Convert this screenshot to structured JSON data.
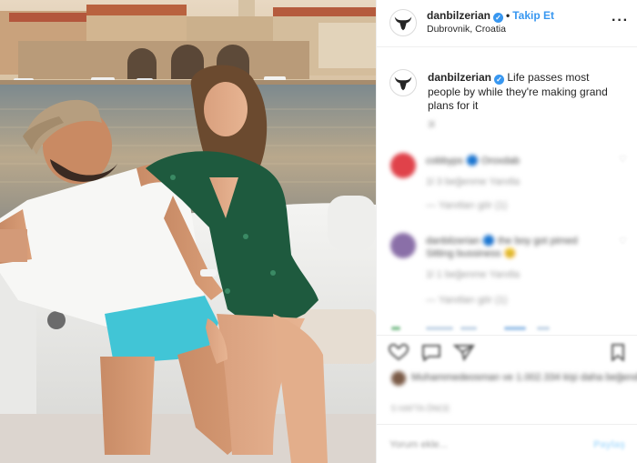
{
  "post": {
    "username": "danbilzerian",
    "separator": "•",
    "follow_label": "Takip Et",
    "location": "Dubrovnik, Croatia",
    "more_icon": "more-options-icon",
    "verified_icon": "verified-badge-icon"
  },
  "caption": {
    "username": "danbilzerian",
    "text": "Life passes most people by while they're making grand plans for it",
    "time": "3l"
  },
  "comments": [
    {
      "line1": "cobbyps 🔵 Oroxdab",
      "line2": "1l  3 beğenme  Yanıtla",
      "line3": "— Yanıtları gör (1)",
      "avatar_color": "#e0424a"
    },
    {
      "line1": "danbilzerian 🔵 the boy got pimed",
      "line2": "Sitting bussiness 😊",
      "line3": "1l  1 beğenme  Yanıtla",
      "line4": "— Yanıtları gör (1)",
      "avatar_color": "#8a6fa8"
    }
  ],
  "actions": {
    "like_icon": "heart-icon",
    "comment_icon": "comment-icon",
    "share_icon": "share-icon",
    "save_icon": "bookmark-icon"
  },
  "likes": {
    "text": "Muhammedeosman ve 1.002.334 kişi daha beğendi",
    "time": "5 HAFTA ÖNCE"
  },
  "add_comment": {
    "placeholder": "Yorum ekle...",
    "post_label": "Paylaş"
  },
  "colors": {
    "accent": "#3897f0",
    "text": "#262626",
    "muted": "#8e8e8e",
    "divider": "#efefef"
  }
}
